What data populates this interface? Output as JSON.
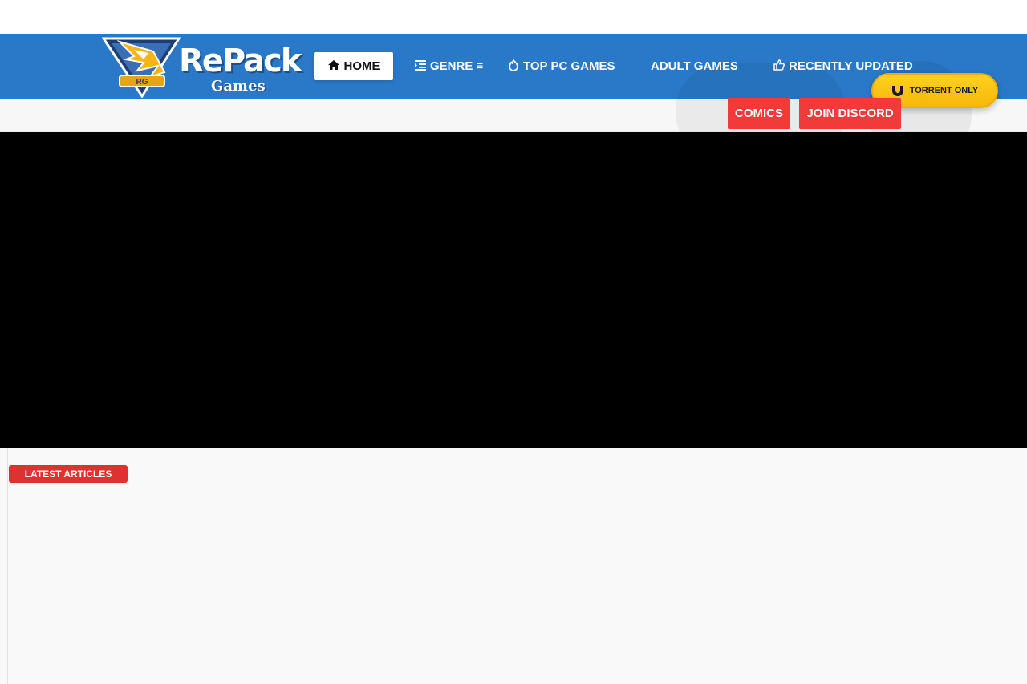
{
  "brand": {
    "logo_text": "RePack",
    "logo_subtext": "Games",
    "badge": "RG"
  },
  "nav": {
    "home": "HOME",
    "genre": "GENRE ≡",
    "top_pc_games": "TOP PC GAMES",
    "adult_games": "ADULT GAMES",
    "recently_updated": "RECENTLY UPDATED"
  },
  "torrent_button": "TORRENT ONLY",
  "subnav": {
    "comics": "COMICS",
    "join_discord": "JOIN DISCORD"
  },
  "sections": {
    "latest_articles": "LATEST ARTICLES"
  },
  "colors": {
    "navbar": "#2a79c8",
    "accent_red": "#f23a3a",
    "torrent_yellow": "#ffd21f"
  },
  "icons": {
    "home": "home-icon",
    "genre": "indent-icon",
    "top_pc_games": "fire-icon",
    "recently_updated": "thumbs-up-icon",
    "torrent": "magnet-icon"
  }
}
